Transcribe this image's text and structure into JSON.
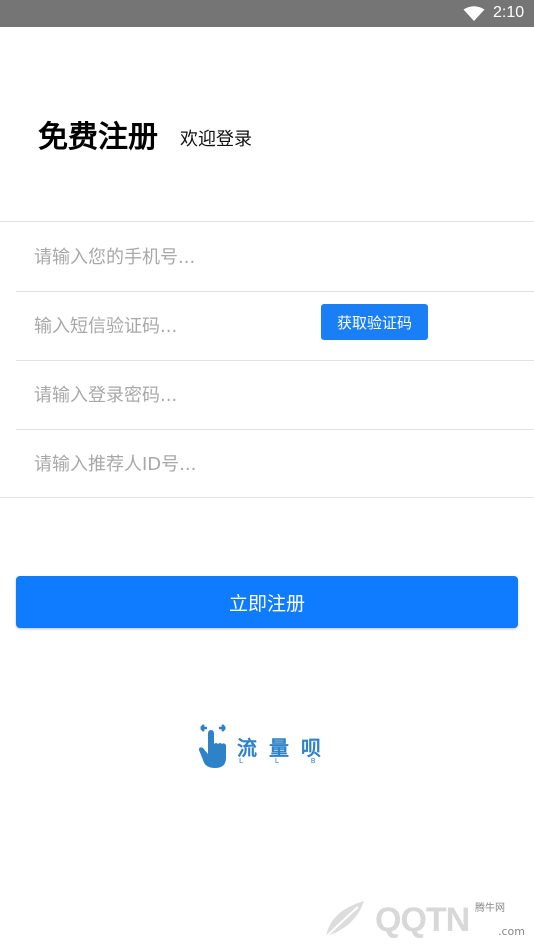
{
  "status_bar": {
    "time": "2:10"
  },
  "header": {
    "title": "免费注册",
    "login_link": "欢迎登录"
  },
  "form": {
    "phone_placeholder": "请输入您的手机号...",
    "sms_placeholder": "输入短信验证码...",
    "sms_button": "获取验证码",
    "password_placeholder": "请输入登录密码...",
    "referrer_placeholder": "请输入推荐人ID号..."
  },
  "register_button": "立即注册",
  "logo": {
    "name": "流量呗",
    "letters": "LLB"
  },
  "watermark": {
    "text": "QQTN",
    "cn": "腾牛网",
    "domain": ".com"
  },
  "colors": {
    "primary": "#0f7bff",
    "logo": "#2e82c8",
    "status_bar": "#757575"
  }
}
